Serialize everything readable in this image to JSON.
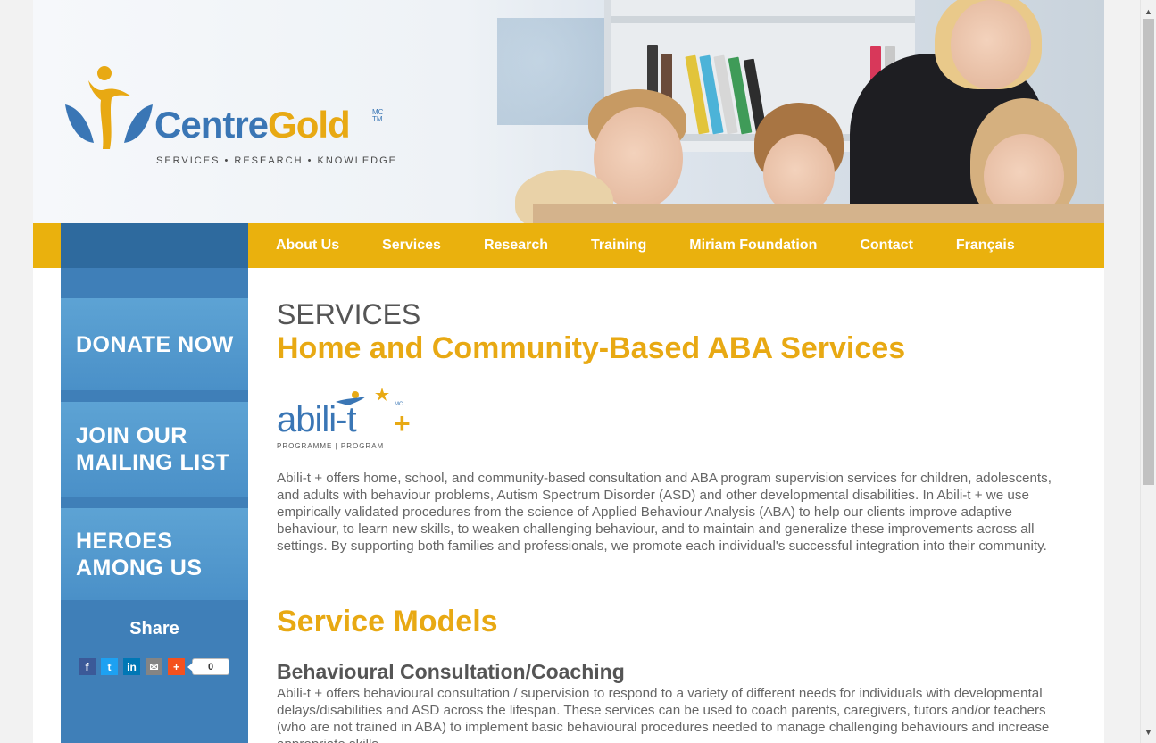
{
  "header": {
    "logo_word_blue": "Centre",
    "logo_word_gold": "Gold",
    "logo_sup": "MC\nTM",
    "logo_tagline": "SERVICES • RESEARCH • KNOWLEDGE"
  },
  "nav": {
    "items": [
      {
        "label": "About Us"
      },
      {
        "label": "Services"
      },
      {
        "label": "Research"
      },
      {
        "label": "Training"
      },
      {
        "label": "Miriam Foundation"
      },
      {
        "label": "Contact"
      },
      {
        "label": "Français"
      }
    ]
  },
  "sidebar": {
    "buttons": [
      {
        "label": "DONATE NOW"
      },
      {
        "label": "JOIN OUR\nMAILING LIST"
      },
      {
        "label": "HEROES\nAMONG US"
      }
    ],
    "share_title": "Share",
    "share_icons": [
      {
        "icon": "facebook-icon",
        "glyph": "f",
        "color": "#3b5998"
      },
      {
        "icon": "twitter-icon",
        "glyph": "t",
        "color": "#1da1f2"
      },
      {
        "icon": "linkedin-icon",
        "glyph": "in",
        "color": "#0077b5"
      },
      {
        "icon": "email-icon",
        "glyph": "✉",
        "color": "#848484"
      },
      {
        "icon": "more-icon",
        "glyph": "+",
        "color": "#f4511e"
      }
    ],
    "share_count": "0"
  },
  "main": {
    "section_label": "SERVICES",
    "title": "Home and Community-Based ABA Services",
    "abilit_logo_text": "abili-t",
    "abilit_logo_plus": "+",
    "abilit_logo_sub": "PROGRAMME | PROGRAM",
    "abilit_logo_sup": "MC",
    "intro": "Abili-t + offers home, school, and community-based consultation and ABA program supervision services for children, adolescents, and adults with behaviour problems, Autism Spectrum Disorder (ASD) and other developmental disabilities.  In Abili-t + we use empirically validated procedures from the science of Applied Behaviour Analysis (ABA) to help our clients improve adaptive behaviour, to learn new skills, to weaken challenging behaviour, and to maintain and generalize these improvements across all settings.  By supporting both families and professionals, we promote each individual's successful integration into their community.",
    "models_heading": "Service Models",
    "sub_heading": "Behavioural Consultation/Coaching",
    "sub_text": "Abili-t + offers behavioural consultation / supervision to respond to a variety of different needs for individuals with developmental delays/disabilities and ASD across the lifespan.  These services can be used to coach parents, caregivers, tutors and/or teachers (who are not trained in ABA) to implement basic behavioural procedures needed to manage challenging behaviours and increase appropriate skills."
  },
  "colors": {
    "accent_gold": "#eab10d",
    "brand_blue": "#3a76b5",
    "sidebar_blue": "#3f7fb8",
    "nav_side": "#2e6a9e"
  }
}
